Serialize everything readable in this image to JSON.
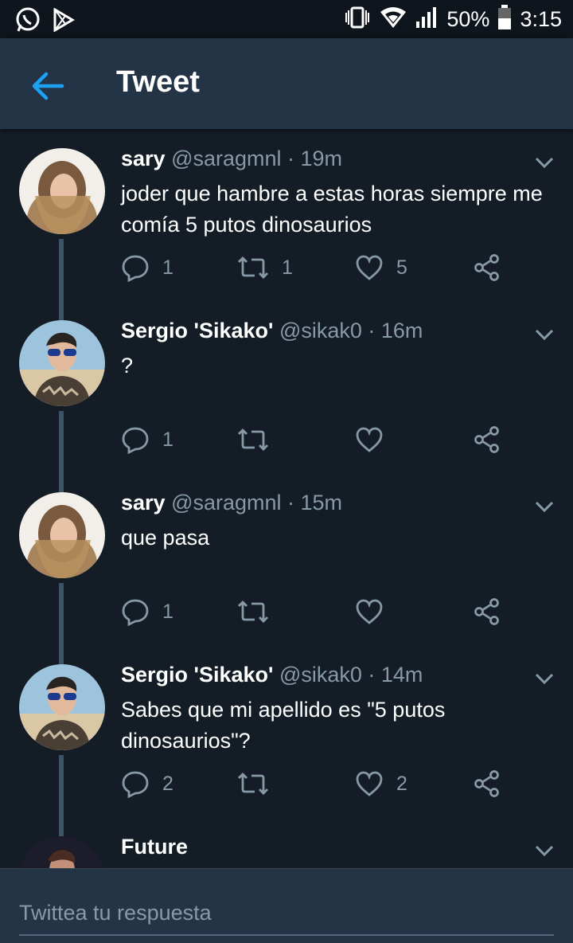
{
  "status_bar": {
    "battery": "50%",
    "time": "3:15",
    "icons": [
      "whatsapp-icon",
      "play-store-icon",
      "vibrate-icon",
      "wifi-icon",
      "signal-icon",
      "battery-icon"
    ]
  },
  "header": {
    "title": "Tweet",
    "back_icon": "arrow-left-icon"
  },
  "colors": {
    "background": "#141d26",
    "header": "#243447",
    "accent": "#1da1f2",
    "muted": "#8899a6"
  },
  "tweets": [
    {
      "name": "sary",
      "meta": "@saragmnl · 19m",
      "text": "joder que hambre a estas horas siempre me comía 5 putos dinosaurios",
      "replies": "1",
      "retweets": "1",
      "likes": "5"
    },
    {
      "name": "Sergio 'Sikako'",
      "meta": "@sikak0 · 16m",
      "text": "?",
      "replies": "1",
      "retweets": "",
      "likes": ""
    },
    {
      "name": "sary",
      "meta": "@saragmnl · 15m",
      "text": "que pasa",
      "replies": "1",
      "retweets": "",
      "likes": ""
    },
    {
      "name": "Sergio 'Sikako'",
      "meta": "@sikak0 · 14m",
      "text": "Sabes que mi apellido es \"5 putos dinosaurios\"?",
      "replies": "2",
      "retweets": "",
      "likes": "2"
    },
    {
      "name": "Future",
      "meta": "",
      "text": "",
      "replies": "",
      "retweets": "",
      "likes": ""
    }
  ],
  "reply": {
    "placeholder": "Twittea tu respuesta"
  }
}
